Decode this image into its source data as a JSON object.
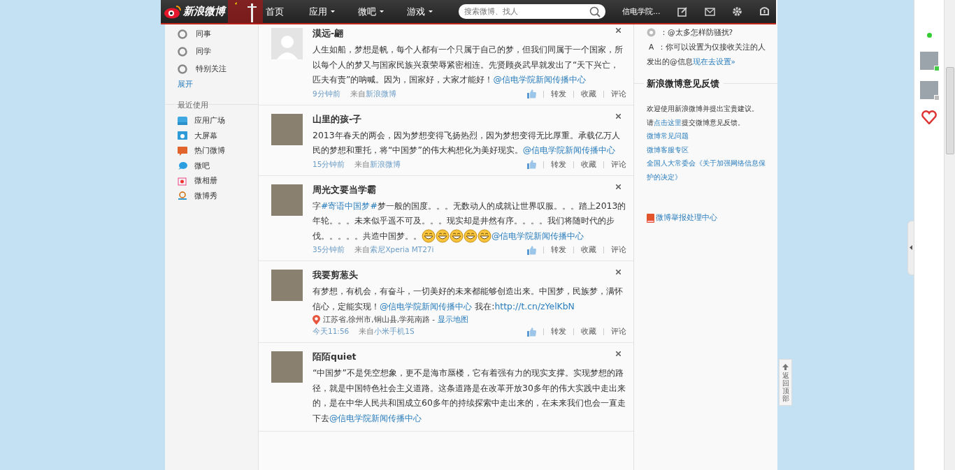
{
  "header": {
    "logo": "新浪微博",
    "nav": [
      {
        "label": "首页",
        "dropdown": false
      },
      {
        "label": "应用",
        "dropdown": true
      },
      {
        "label": "微吧",
        "dropdown": true
      },
      {
        "label": "游戏",
        "dropdown": true
      }
    ],
    "search": {
      "placeholder": "搜索微博、找人"
    },
    "user": "信电学院..."
  },
  "sidebar": {
    "groups": [
      {
        "label": "同事"
      },
      {
        "label": "同学"
      },
      {
        "label": "特别关注"
      }
    ],
    "expand": "展开",
    "recent_title": "最近使用",
    "recent": [
      {
        "label": "应用广场",
        "kind": "app"
      },
      {
        "label": "大屏幕",
        "kind": "screen"
      },
      {
        "label": "热门微博",
        "kind": "hot"
      },
      {
        "label": "微吧",
        "kind": "bar"
      },
      {
        "label": "微相册",
        "kind": "album"
      },
      {
        "label": "微博秀",
        "kind": "show"
      }
    ]
  },
  "posts": [
    {
      "author": "漠远-翩",
      "avatar": {
        "kind": "default"
      },
      "segments": [
        {
          "kind": "text",
          "text": "人生如船，梦想是帆，每个人都有一个只属于自己的梦，但我们同属于一个国家，所以每个人的梦又与国家民族兴衰荣辱紧密相连。先贤顾炎武早就发出了“天下兴亡，匹夫有责”的呐喊。因为，国家好，大家才能好！"
        },
        {
          "kind": "link",
          "text": "@信电学院新闻传播中心"
        }
      ],
      "time": "9分钟前",
      "from": "来自",
      "source": "新浪微博",
      "actions": [
        "转发",
        "收藏",
        "评论"
      ]
    },
    {
      "author": "山里的孩-子",
      "avatar": {
        "kind": "photo"
      },
      "segments": [
        {
          "kind": "text",
          "text": "2013年春天的两会，因为梦想变得飞扬热烈，因为梦想变得无比厚重。承载亿万人民的梦想和重托，将“中国梦”的伟大构想化为美好现实。"
        },
        {
          "kind": "link",
          "text": "@信电学院新闻传播中心"
        }
      ],
      "time": "15分钟前",
      "from": "来自",
      "source": "新浪微博",
      "actions": [
        "转发",
        "收藏",
        "评论"
      ]
    },
    {
      "author": "周光文要当学霸",
      "avatar": {
        "kind": "photo"
      },
      "segments": [
        {
          "kind": "text",
          "text": "字"
        },
        {
          "kind": "link",
          "text": "#寄语中国梦#"
        },
        {
          "kind": "text",
          "text": "梦一般的国度。。。无数动人的成就让世界叹服。。。踏上2013的年轮。。。未来似乎遥不可及。。。现实却是井然有序。。。。我们将随时代的步伐。。。。。共造中国梦。。"
        },
        {
          "kind": "emoji"
        },
        {
          "kind": "emoji"
        },
        {
          "kind": "emoji"
        },
        {
          "kind": "emoji"
        },
        {
          "kind": "emoji"
        },
        {
          "kind": "link",
          "text": "@信电学院新闻传播中心"
        }
      ],
      "time": "35分钟前",
      "from": "来自",
      "source": "索尼Xperia MT27i",
      "actions": [
        "转发",
        "收藏",
        "评论"
      ]
    },
    {
      "author": "我要剪葱头",
      "avatar": {
        "kind": "photo"
      },
      "segments": [
        {
          "kind": "text",
          "text": "有梦想，有机会，有奋斗，一切美好的未来都能够创造出来。中国梦，民族梦，满怀信心，定能实现！"
        },
        {
          "kind": "link",
          "text": "@信电学院新闻传播中心"
        },
        {
          "kind": "text",
          "text": " 我在:"
        },
        {
          "kind": "link",
          "text": "http://t.cn/zYelKbN"
        }
      ],
      "location": {
        "text": "江苏省,徐州市,铜山县,学苑南路 -",
        "map": "显示地图"
      },
      "time": "今天11:56",
      "from": "来自",
      "source": "小米手机1S",
      "actions": [
        "转发",
        "收藏",
        "评论"
      ]
    },
    {
      "author": "陌陌quiet",
      "avatar": {
        "kind": "photo"
      },
      "segments": [
        {
          "kind": "text",
          "text": "“中国梦”不是凭空想象，更不是海市蜃楼，它有着强有力的现实支撑。实现梦想的路径，就是中国特色社会主义道路。这条道路是在改革开放30多年的伟大实践中走出来的，是在中华人民共和国成立60多年的持续探索中走出来的，在未来我们也会一直走下去"
        },
        {
          "kind": "link",
          "text": "@信电学院新闻传播中心"
        }
      ]
    }
  ],
  "right": {
    "tips": [
      {
        "kind": "question",
        "text": "：@太多怎样防骚扰?"
      },
      {
        "kind": "answer",
        "mark": "A",
        "text": "：你可以设置为仅接收关注的人发出的@信息",
        "link": "现在去设置»"
      }
    ],
    "feedback_title": "新浪微博意见反馈",
    "feedback_intro": "欢迎使用新浪微博并提出宝贵建议。",
    "feedback_pre": "请",
    "feedback_link": "点击这里",
    "feedback_post": "提交微博意见反馈。",
    "links": [
      "微博常见问题",
      "微博客服专区",
      "全国人大常委会《关于加强网络信息保护的决定》"
    ],
    "report": "微博举报处理中心"
  },
  "back_to_top": "返回顶部",
  "dock": {
    "online": true,
    "contacts": [
      {
        "online": true
      },
      {
        "online": false
      }
    ]
  }
}
